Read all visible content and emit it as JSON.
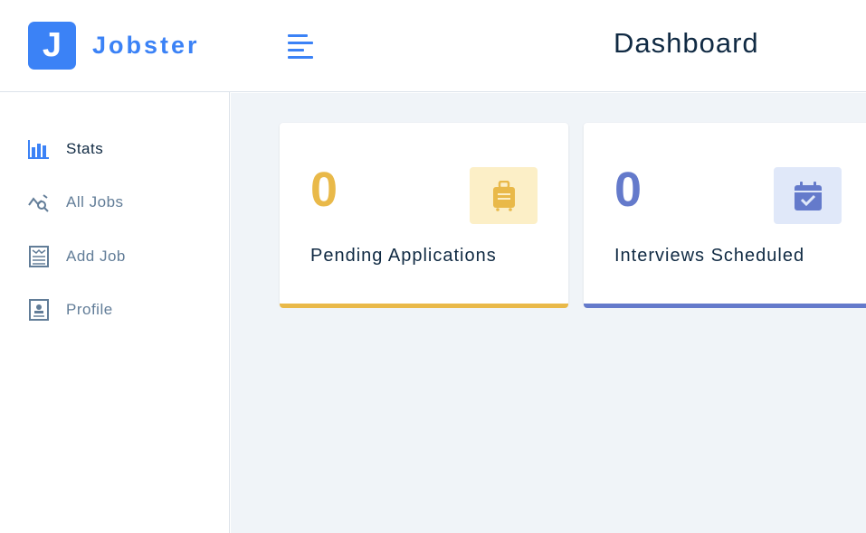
{
  "brand": {
    "mark": "J",
    "name": "Jobster",
    "color": "#3b82f6"
  },
  "header": {
    "title": "Dashboard",
    "menu_icon": "bars-icon"
  },
  "sidebar": {
    "items": [
      {
        "label": "Stats",
        "icon": "bar-chart-icon",
        "active": true
      },
      {
        "label": "All Jobs",
        "icon": "job-search-icon",
        "active": false
      },
      {
        "label": "Add Job",
        "icon": "form-icon",
        "active": false
      },
      {
        "label": "Profile",
        "icon": "profile-card-icon",
        "active": false
      }
    ]
  },
  "stats": [
    {
      "count": "0",
      "title": "Pending Applications",
      "icon": "suitcase-icon",
      "color": "#e9b949",
      "bg": "#fcefc7"
    },
    {
      "count": "0",
      "title": "Interviews Scheduled",
      "icon": "calendar-check-icon",
      "color": "#647acb",
      "bg": "#e0e8f9"
    }
  ]
}
